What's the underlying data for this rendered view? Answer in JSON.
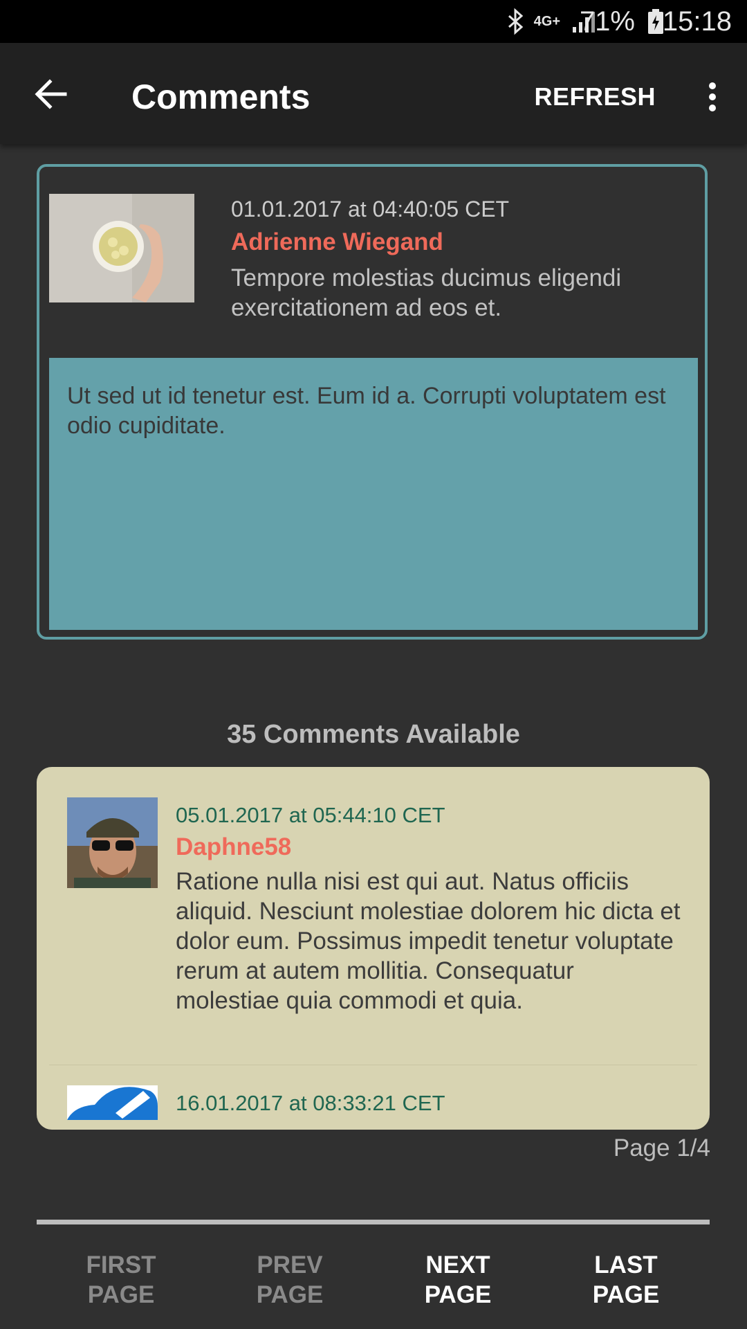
{
  "status_bar": {
    "battery": "71%",
    "time": "15:18",
    "network": "4G+"
  },
  "app_bar": {
    "title": "Comments",
    "refresh_label": "REFRESH"
  },
  "selected_comment": {
    "date": "01.01.2017 at 04:40:05 CET",
    "author": "Adrienne Wiegand",
    "title": "Tempore molestias ducimus eligendi exercitationem ad eos et.",
    "body": "Ut sed ut id tenetur est. Eum id a. Corrupti voluptatem est odio cupiditate."
  },
  "comments_count_label": "35 Comments Available",
  "comments": [
    {
      "date": "05.01.2017 at 05:44:10 CET",
      "author": "Daphne58",
      "text": "Ratione nulla nisi est qui aut. Natus officiis aliquid. Nesciunt molestiae dolorem hic dicta et dolor eum. Possimus impedit tenetur voluptate rerum at autem mollitia. Consequatur molestiae quia commodi et quia."
    },
    {
      "date": "16.01.2017 at 08:33:21 CET"
    }
  ],
  "page_indicator": "Page 1/4",
  "pagination": {
    "first": {
      "line1": "FIRST",
      "line2": "PAGE"
    },
    "prev": {
      "line1": "PREV",
      "line2": "PAGE"
    },
    "next": {
      "line1": "NEXT",
      "line2": "PAGE"
    },
    "last": {
      "line1": "LAST",
      "line2": "PAGE"
    }
  },
  "colors": {
    "accent_author": "#ef6a5a",
    "selected_border": "#5f9ea3",
    "selected_body_bg": "#64a1aa",
    "list_bg": "#d8d4b2",
    "date_green": "#1f6650"
  },
  "icons": [
    "bluetooth-icon",
    "signal-icon",
    "battery-icon",
    "back-arrow-icon",
    "overflow-menu-icon"
  ]
}
